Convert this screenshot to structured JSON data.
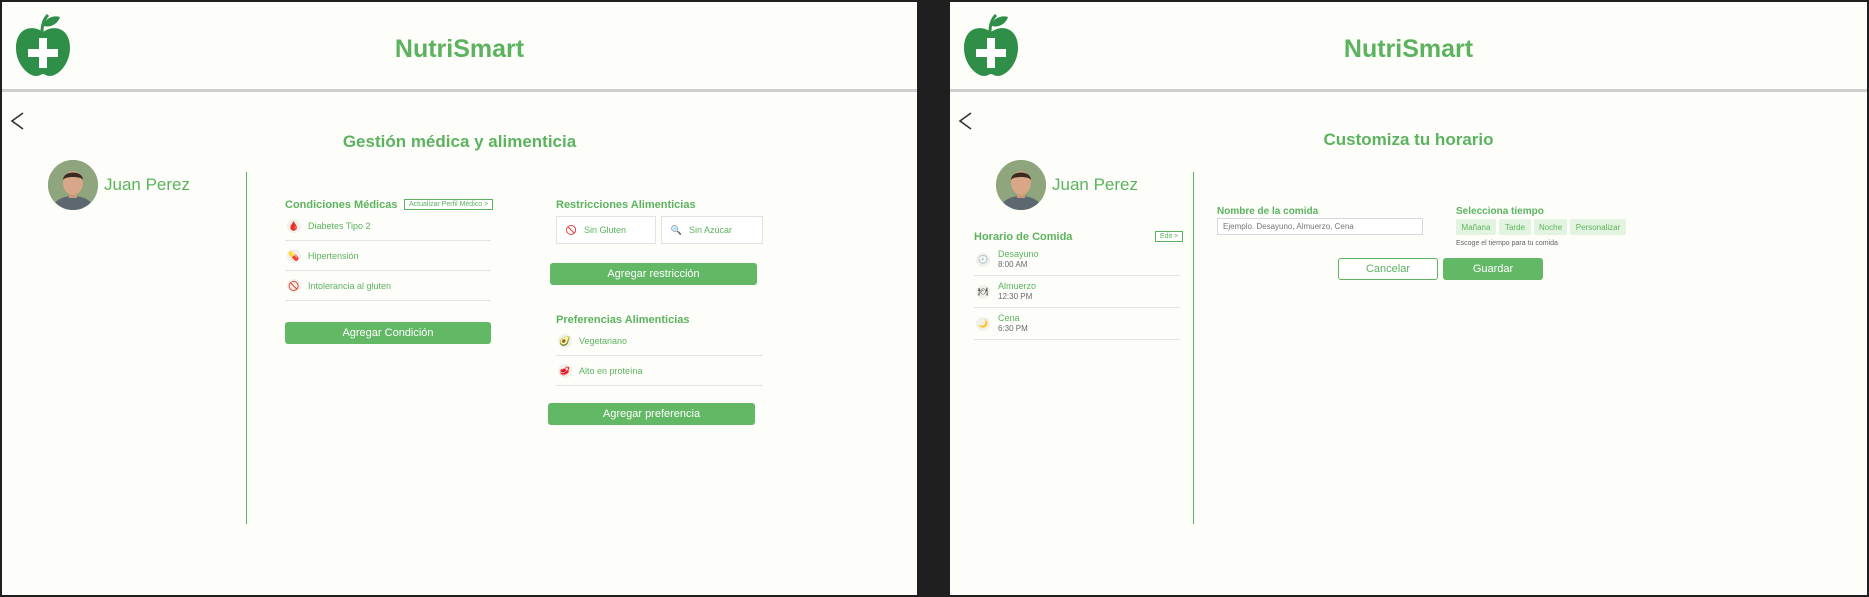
{
  "app": {
    "title": "NutriSmart"
  },
  "colors": {
    "accent": "#5cb35f",
    "button": "#63b866",
    "background": "#fdfdf9",
    "frame": "#1f1f1f"
  },
  "left": {
    "page_title": "Gestión médica y alimenticia",
    "user_name": "Juan Perez",
    "conditions": {
      "title": "Condiciones Médicas",
      "update_link": "Actualizar Perfil Médico >",
      "items": [
        {
          "label": "Diabetes Tipo 2",
          "icon": "glucose-meter-icon"
        },
        {
          "label": "Hipertensión",
          "icon": "pills-icon"
        },
        {
          "label": "Intolerancia al gluten",
          "icon": "no-gluten-icon"
        }
      ],
      "add_label": "Agregar Condición"
    },
    "restrictions": {
      "title": "Restricciones Alimenticias",
      "items": [
        {
          "label": "Sin Gluten",
          "icon": "no-gluten-icon"
        },
        {
          "label": "Sin Azúcar",
          "icon": "no-sugar-icon"
        }
      ],
      "add_label": "Agregar restricción"
    },
    "preferences": {
      "title": "Preferencias Alimenticias",
      "items": [
        {
          "label": "Vegetariano",
          "icon": "avocado-icon"
        },
        {
          "label": "Alto en proteína",
          "icon": "meat-icon"
        }
      ],
      "add_label": "Agregar preferencia"
    }
  },
  "right": {
    "page_title": "Customiza tu horario",
    "user_name": "Juan Perez",
    "schedule": {
      "title": "Horario de Comida",
      "edit_label": "Edit >",
      "meals": [
        {
          "name": "Desayuno",
          "time": "8:00 AM",
          "icon": "clock-icon"
        },
        {
          "name": "Almuerzo",
          "time": "12:30 PM",
          "icon": "plate-icon"
        },
        {
          "name": "Cena",
          "time": "6:30 PM",
          "icon": "moon-icon"
        }
      ]
    },
    "form": {
      "name_label": "Nombre de la comida",
      "name_placeholder": "Ejemplo. Desayuno, Almuerzo, Cena",
      "time_label": "Selecciona tiempo",
      "time_options": [
        "Mañana",
        "Tarde",
        "Noche",
        "Personalizar"
      ],
      "time_hint": "Escoge el tiempo para tu comida",
      "cancel_label": "Cancelar",
      "save_label": "Guardar"
    }
  }
}
